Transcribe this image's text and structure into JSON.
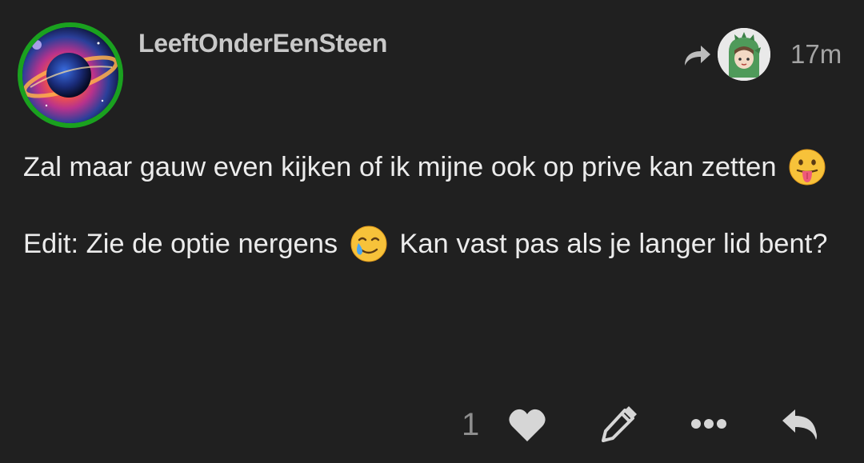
{
  "post": {
    "username": "LeeftOnderEenSteen",
    "timestamp": "17m",
    "paragraphs": [
      {
        "before": "Zal maar gauw even kijken of ik mijne ook op prive kan zetten",
        "emoji": "tongue-out-emoji",
        "after": ""
      },
      {
        "before": "Edit: Zie de optie nergens",
        "emoji": "smiling-tear-emoji",
        "after": "Kan vast pas als je langer lid bent?"
      }
    ]
  },
  "footer": {
    "like_count": "1",
    "icons": [
      "heart-icon",
      "edit-icon",
      "more-icon",
      "reply-icon"
    ]
  },
  "colors": {
    "background": "#202020",
    "avatar_ring": "#1aa11f",
    "text": "#ececec",
    "muted": "#8e8e8e"
  }
}
